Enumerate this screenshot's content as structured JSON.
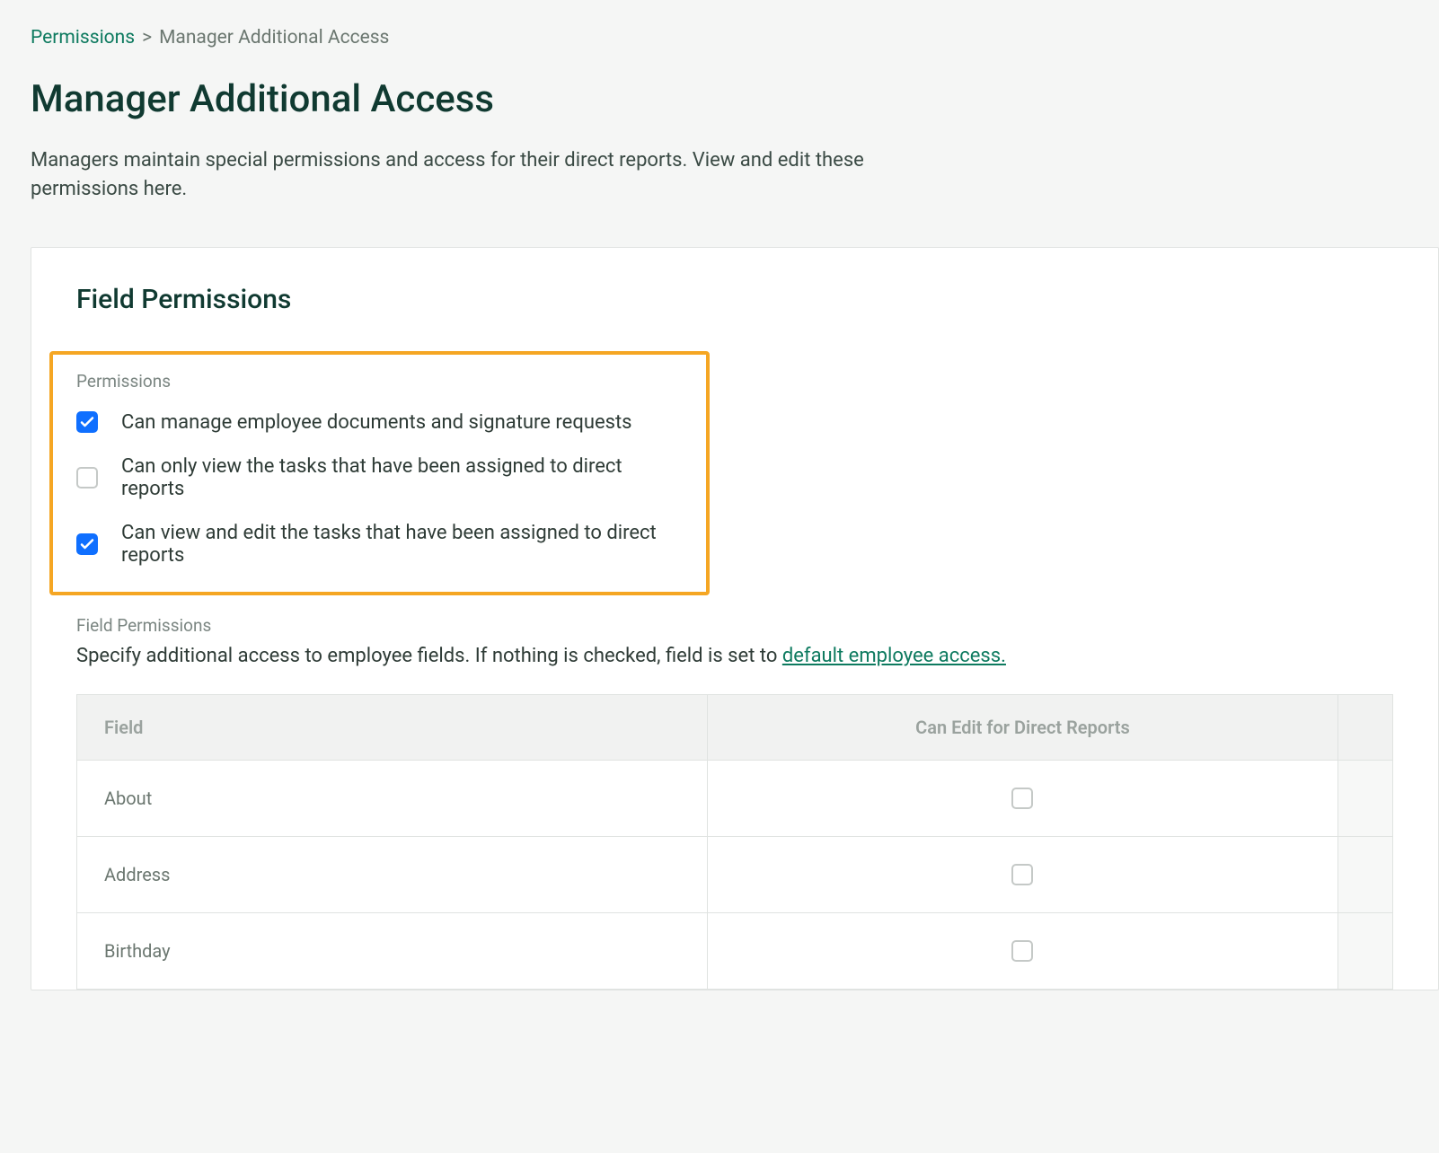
{
  "breadcrumb": {
    "root": "Permissions",
    "separator": ">",
    "current": "Manager Additional Access"
  },
  "page": {
    "title": "Manager Additional Access",
    "description": "Managers maintain special permissions and access for their direct reports. View and edit these permissions here."
  },
  "card": {
    "title": "Field Permissions",
    "permissions_label": "Permissions",
    "permissions": [
      {
        "label": "Can manage employee documents and signature requests",
        "checked": true
      },
      {
        "label": "Can only view the tasks that have been assigned to direct reports",
        "checked": false
      },
      {
        "label": "Can view and edit the tasks that have been assigned to direct reports",
        "checked": true
      }
    ],
    "field_permissions_label": "Field Permissions",
    "field_permissions_desc_prefix": "Specify additional access to employee fields. If nothing is checked, field is set to ",
    "field_permissions_link": "default employee access.",
    "table": {
      "headers": {
        "field": "Field",
        "can_edit": "Can Edit for Direct Reports"
      },
      "rows": [
        {
          "field": "About",
          "checked": false
        },
        {
          "field": "Address",
          "checked": false
        },
        {
          "field": "Birthday",
          "checked": false
        }
      ]
    }
  }
}
